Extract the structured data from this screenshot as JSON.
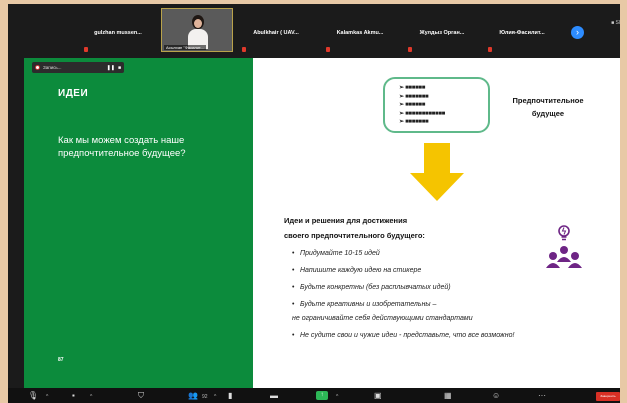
{
  "participants": [
    {
      "name": "gulzhan  mussen..."
    },
    {
      "name": "Асылхан \"Фасилит...",
      "has_video": true
    },
    {
      "name": "Abulkhair ( UAV..."
    },
    {
      "name": "Kalamkas  Akmu..."
    },
    {
      "name": "Жулдыз  Орган..."
    },
    {
      "name": "Юлия-Фасилит..."
    }
  ],
  "next_icon": "chevron-right-icon",
  "corner_label": "■ Sl",
  "recording": {
    "label": "Запись...",
    "pause": "❚❚",
    "stop": "■"
  },
  "slide": {
    "title": "ИДЕИ",
    "question": "Как мы можем создать наше предпочтительное будущее?",
    "page_number": "87",
    "list_items": [
      "➢ ■■■■■■",
      "➢ ■■■■■■■",
      "➢ ■■■■■■",
      "➢ ■■■■■■■■■■■■",
      "➢ ■■■■■■■"
    ],
    "preferred_future": "Предпочтительное будущее",
    "ideas_heading_line1": "Идеи и решения для достижения",
    "ideas_heading_line2": "своего предпочтительного будущего:",
    "bullets": [
      "Придумайте 10-15 идей",
      "Напишите каждую идею на стикере",
      "Будьте конкретны (без расплывчатых идей)",
      "Будьте креативны и изобретательны –",
      "Не судите свои и чужие идеи - представьте, что все возможно!"
    ],
    "bullet_continuation": "не ограничивайте себя действующими стандартами"
  },
  "colors": {
    "green": "#0c8b3c",
    "arrow": "#f5c400",
    "box_border": "#5fb98a",
    "people_icon": "#6e2585"
  },
  "toolbar": {
    "mute_icon": "microphone-icon",
    "video_icon": "video-icon",
    "security_icon": "shield-icon",
    "participants_label": "92",
    "share_label": "↑",
    "chat_icon": "chat-icon",
    "end_label": "Завершить"
  }
}
